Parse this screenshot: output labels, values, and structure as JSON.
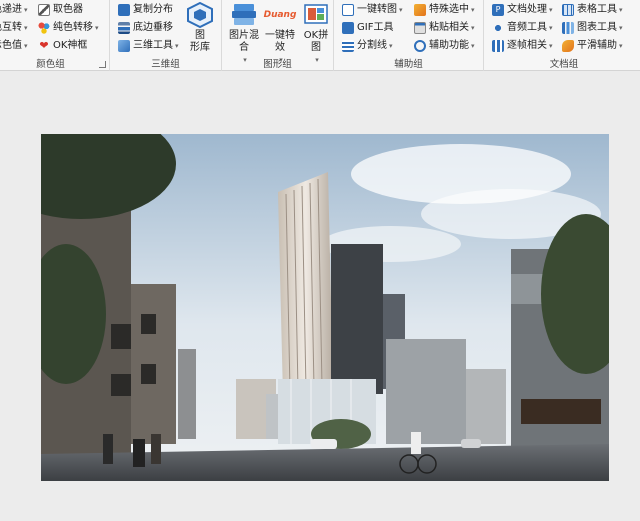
{
  "ribbon": {
    "color_group": {
      "label": "颜色组",
      "items": [
        "色递进",
        "取色器",
        "色互转",
        "纯色转移",
        "示色值",
        "OK神框"
      ]
    },
    "threed_group": {
      "label": "三维组",
      "items": [
        "复制分布",
        "底边垂移",
        "三维工具"
      ],
      "big_button": [
        "图",
        "形库"
      ]
    },
    "shape_group": {
      "label": "图形组",
      "buttons": [
        {
          "line1": "图片混",
          "line2": "合"
        },
        {
          "logo": "Duang",
          "line1": "一键特",
          "line2": "效"
        },
        {
          "line1": "OK拼",
          "line2": "图"
        }
      ]
    },
    "assist_group": {
      "label": "辅助组",
      "items": [
        "一键转图",
        "特殊选中",
        "GIF工具",
        "粘贴相关",
        "分割线",
        "辅助功能"
      ]
    },
    "doc_group": {
      "label": "文档组",
      "items": [
        "文档处理",
        "表格工具",
        "音频工具",
        "图表工具",
        "逐帧相关",
        "平滑辅助"
      ]
    }
  },
  "colors": {
    "ribbon_bg": "#f6f6f6",
    "workspace_bg": "#ececec",
    "accent_blue": "#2f6fba"
  }
}
